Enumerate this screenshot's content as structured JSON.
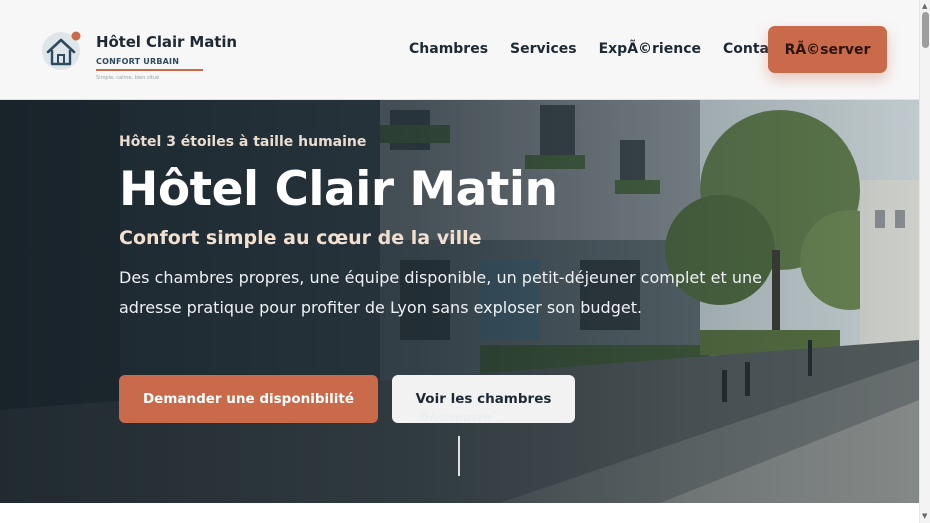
{
  "header": {
    "brand_name": "Hôtel Clair Matin",
    "brand_sub": "CONFORT URBAIN",
    "brand_tagline": "Simple, calme, bien situé",
    "brand_icon": "house-icon",
    "nav": [
      {
        "label": "Chambres"
      },
      {
        "label": "Services"
      },
      {
        "label": "ExpÃ©rience"
      },
      {
        "label": "Contact"
      }
    ],
    "reserve_label": "RÃ©server"
  },
  "hero": {
    "eyebrow": "Hôtel 3 étoiles à taille humaine",
    "title": "Hôtel Clair Matin",
    "subtitle": "Confort simple au cœur de la ville",
    "description": "Des chambres propres, une équipe disponible, un petit-déjeuner complet et une adresse pratique pour profiter de Lyon sans exploser son budget.",
    "cta_primary": "Demander une disponibilité",
    "cta_secondary": "Voir les chambres",
    "scroll_hint": "DÃ©couvrir"
  },
  "colors": {
    "accent": "#c96a4b",
    "navy": "#1d2a36",
    "header_bg": "#f7f7f7"
  }
}
